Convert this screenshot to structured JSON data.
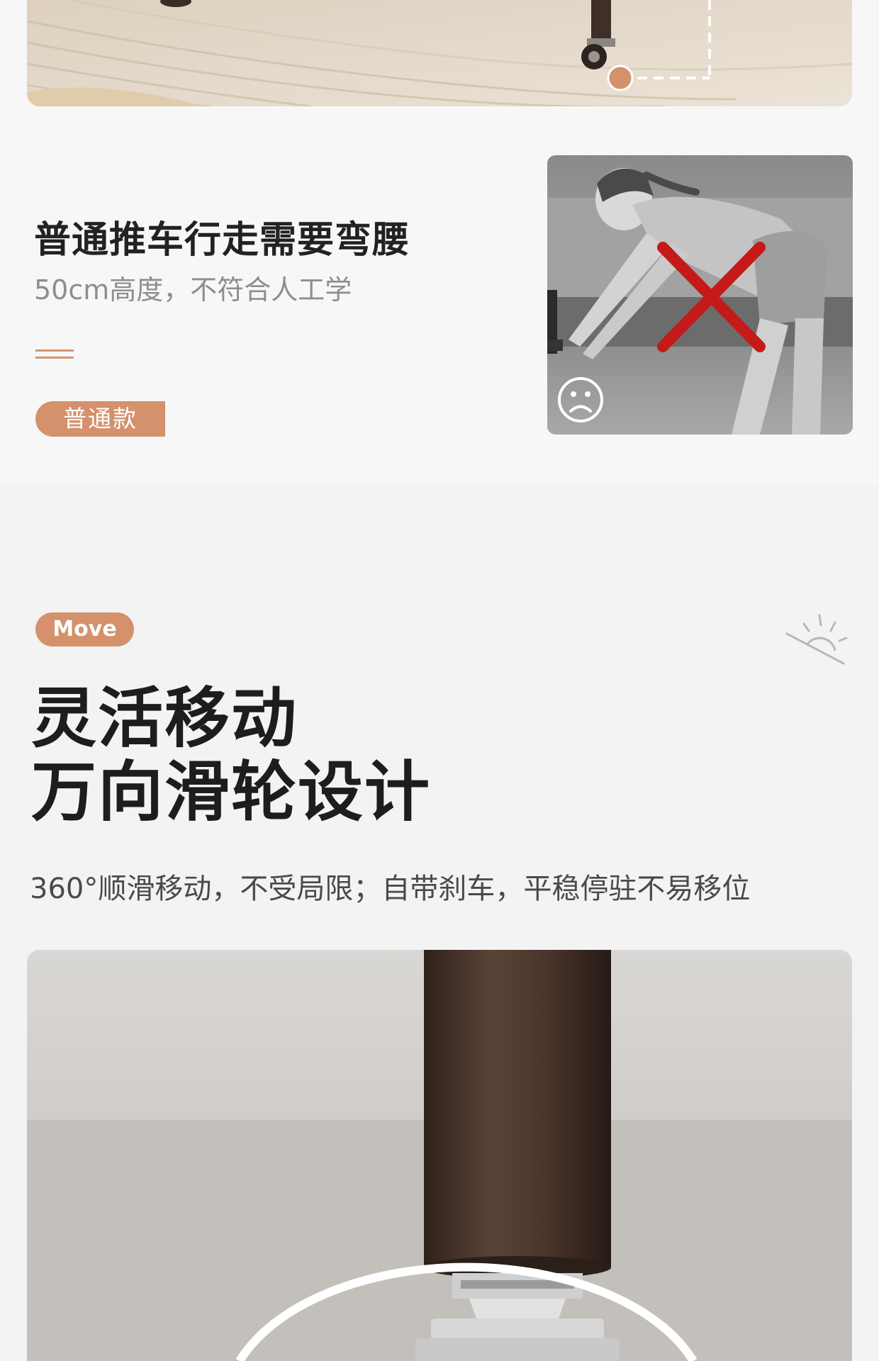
{
  "comparison": {
    "title": "普通推车行走需要弯腰",
    "subtitle": "50cm高度，不符合人工学",
    "tag": "普通款",
    "photo_alt": "",
    "mark": "cross-mark-icon",
    "face": "sad-face-icon"
  },
  "move": {
    "tag": "Move",
    "title_line1": "灵活移动",
    "title_line2": "万向滑轮设计",
    "description": "360°顺滑移动，不受局限；自带刹车，平稳停驻不易移位"
  },
  "colors": {
    "accent": "#d4916b",
    "title": "#1d1d1d",
    "subtle": "#8e8e8e",
    "cross": "#c51a1a",
    "background": "#f3f3f3"
  },
  "icons": {
    "decor": "sun-horizon-icon"
  }
}
